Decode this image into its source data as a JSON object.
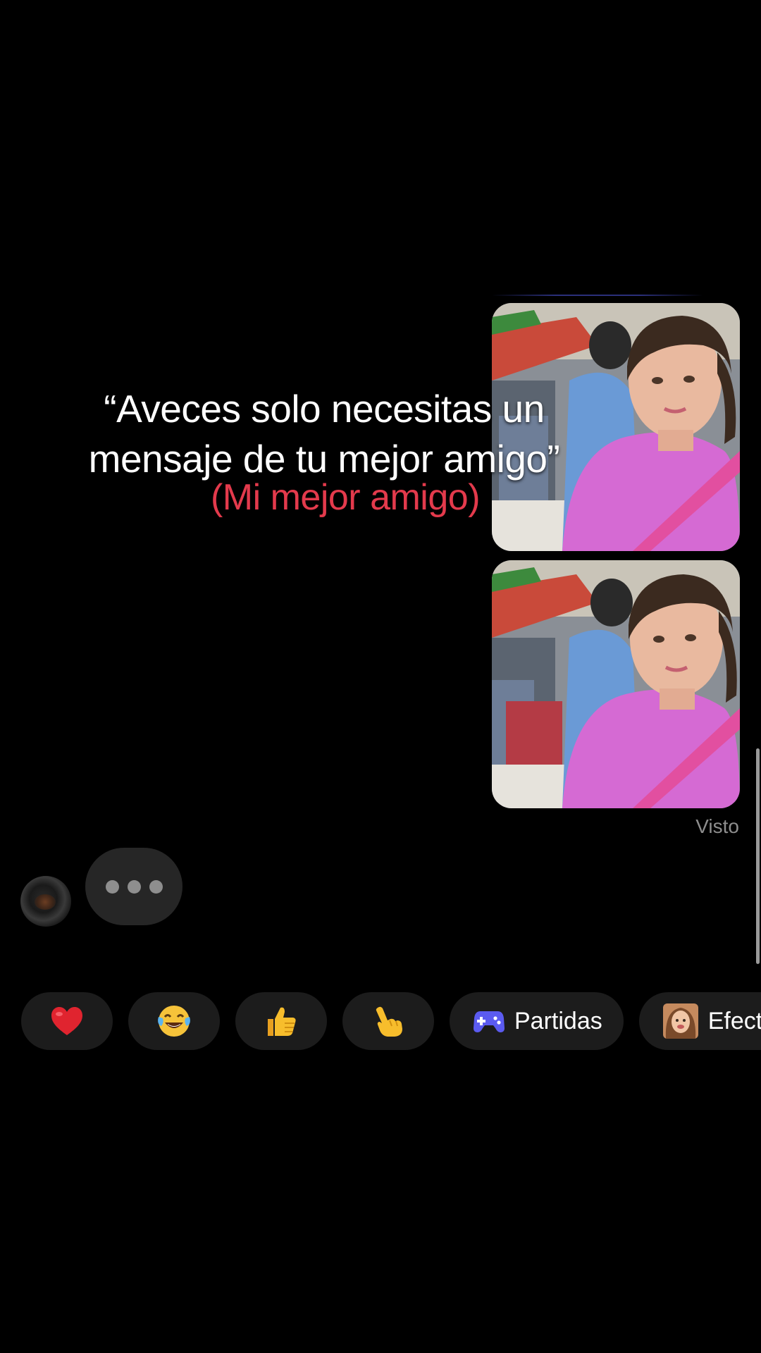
{
  "caption": {
    "line1": "“Aveces solo necesitas un",
    "line2": "mensaje de tu mejor amigo”",
    "subtitle": "(Mi mejor amigo)"
  },
  "chat": {
    "status": "Visto",
    "messages": [
      {
        "type": "image",
        "icon": "meme-photo"
      },
      {
        "type": "image",
        "icon": "meme-photo"
      }
    ],
    "typing_indicator": true
  },
  "quick_actions": [
    {
      "icon": "red-heart-emoji",
      "label": ""
    },
    {
      "icon": "tears-of-joy-emoji",
      "label": ""
    },
    {
      "icon": "thumbs-up-emoji",
      "label": ""
    },
    {
      "icon": "pointing-hand-emoji",
      "label": ""
    },
    {
      "icon": "gamepad-icon",
      "label": "Partidas"
    },
    {
      "icon": "effect-face-icon",
      "label": "Efectos"
    }
  ],
  "colors": {
    "background": "#000000",
    "caption_red": "#e33a4c",
    "bubble": "#262626",
    "chip": "#1c1c1c",
    "gamepad": "#5b5bf0"
  }
}
